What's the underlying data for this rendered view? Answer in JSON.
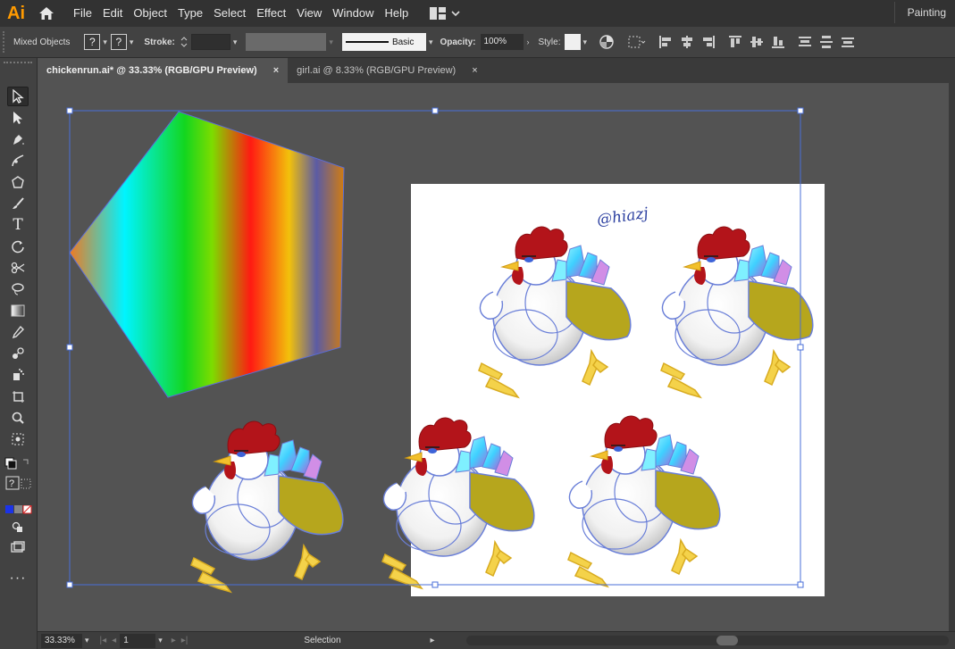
{
  "app": {
    "logo": "Ai",
    "workspace": "Painting"
  },
  "menu": [
    "File",
    "Edit",
    "Object",
    "Type",
    "Select",
    "Effect",
    "View",
    "Window",
    "Help"
  ],
  "control_bar": {
    "selection_label": "Mixed Objects",
    "fill_button": "?",
    "stroke_button": "?",
    "stroke_label": "Stroke:",
    "brush_label": "Basic",
    "opacity_label": "Opacity:",
    "opacity_value": "100%",
    "style_label": "Style:"
  },
  "tabs": [
    {
      "label": "chickenrun.ai* @ 33.33% (RGB/GPU Preview)",
      "close": "×",
      "active": true
    },
    {
      "label": "girl.ai @ 8.33% (RGB/GPU Preview)",
      "close": "×",
      "active": false
    }
  ],
  "artwork": {
    "signature": "@hiazj",
    "gradient_colors": [
      "#f07a22",
      "#00f4ff",
      "#13d61f",
      "#7ddc00",
      "#ff1a12",
      "#f2c10b",
      "#5b5ba4",
      "#d07c12"
    ],
    "chicken_colors": {
      "comb": "#b3141a",
      "body": "#ffffff",
      "outline": "#6a7fd8",
      "cape": "#b6a61d",
      "feet": "#f4d24a",
      "beak": "#f2c02c"
    },
    "selection_color": "#4a6fd8"
  },
  "status_bar": {
    "zoom": "33.33%",
    "page": "1",
    "tool": "Selection"
  }
}
